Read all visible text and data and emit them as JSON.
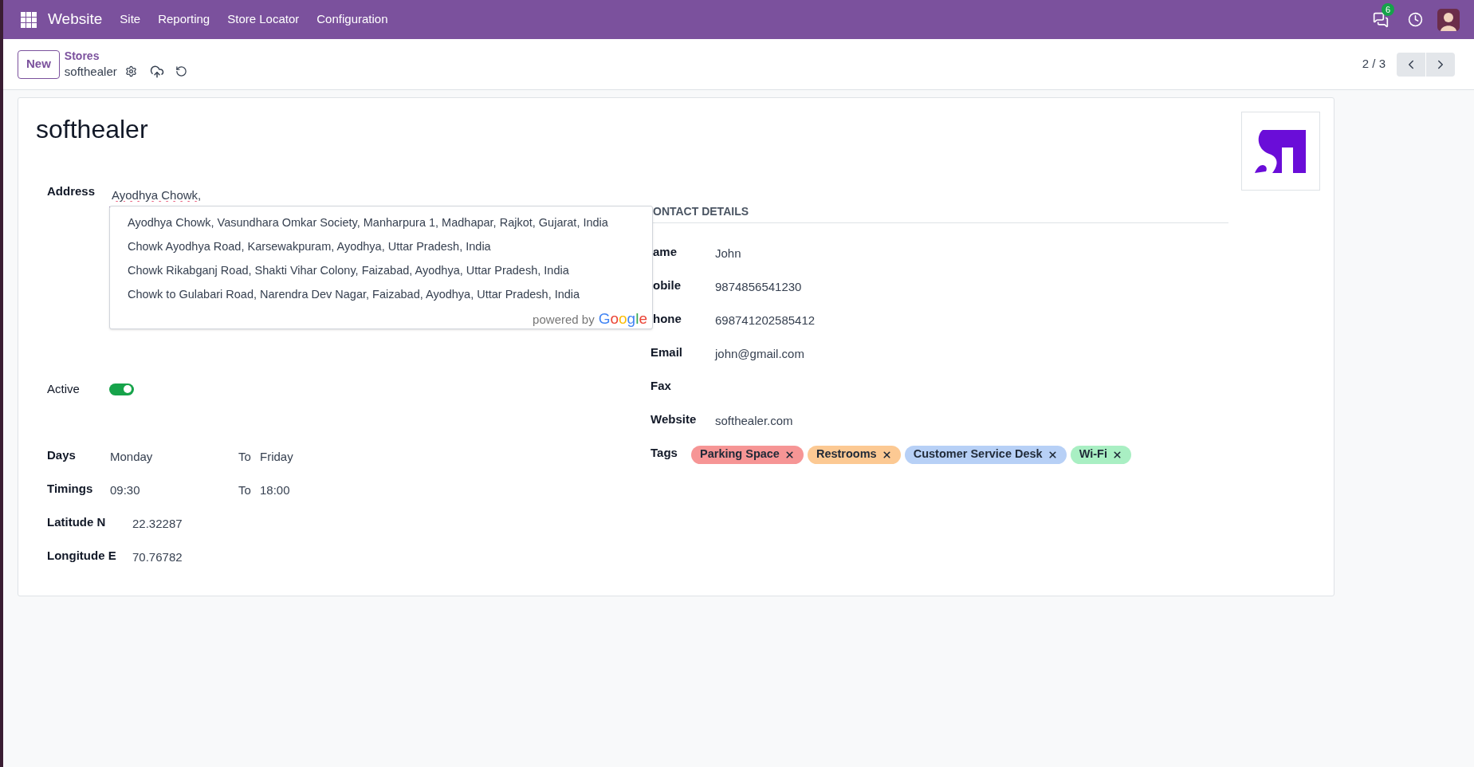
{
  "navbar": {
    "app_name": "Website",
    "menu": [
      "Site",
      "Reporting",
      "Store Locator",
      "Configuration"
    ],
    "messages_badge": "6"
  },
  "control_panel": {
    "new_button": "New",
    "breadcrumb": "Stores",
    "record": "softhealer",
    "pager": "2 / 3"
  },
  "form": {
    "title": "softhealer",
    "address": {
      "label": "Address",
      "value": "Ayodhya Chowk,",
      "suggestions": [
        "Ayodhya Chowk, Vasundhara Omkar Society, Manharpura 1, Madhapar, Rajkot, Gujarat, India",
        "Chowk Ayodhya Road, Karsewakpuram, Ayodhya, Uttar Pradesh, India",
        "Chowk Rikabganj Road, Shakti Vihar Colony, Faizabad, Ayodhya, Uttar Pradesh, India",
        "Chowk to Gulabari Road, Narendra Dev Nagar, Faizabad, Ayodhya, Uttar Pradesh, India"
      ],
      "powered_by": "powered by",
      "provider": "Google"
    },
    "active": {
      "label": "Active",
      "on": true
    },
    "schedule": [
      {
        "label": "Days",
        "from": "Monday",
        "to_label": "To",
        "to": "Friday"
      },
      {
        "label": "Timings",
        "from": "09:30",
        "to_label": "To",
        "to": "18:00"
      }
    ],
    "coordinates": [
      {
        "label": "Latitude N",
        "value": "22.32287"
      },
      {
        "label": "Longitude E",
        "value": "70.76782"
      }
    ],
    "contact_details": {
      "heading": "ONTACT DETAILS",
      "fields": [
        {
          "label": "ame",
          "value": "John"
        },
        {
          "label": "obile",
          "value": "9874856541230"
        },
        {
          "label": "hone",
          "value": "698741202585412"
        },
        {
          "label": "Email",
          "value": "john@gmail.com"
        },
        {
          "label": "Fax"
        },
        {
          "label": "Website",
          "value": "softhealer.com"
        }
      ],
      "tags_label": "Tags",
      "tags": [
        {
          "label": "Parking Space",
          "color": "#f69595"
        },
        {
          "label": "Restrooms",
          "color": "#fcc993"
        },
        {
          "label": "Customer Service Desk",
          "color": "#b7d0f6"
        },
        {
          "label": "Wi-Fi",
          "color": "#a9efc3"
        }
      ]
    }
  }
}
